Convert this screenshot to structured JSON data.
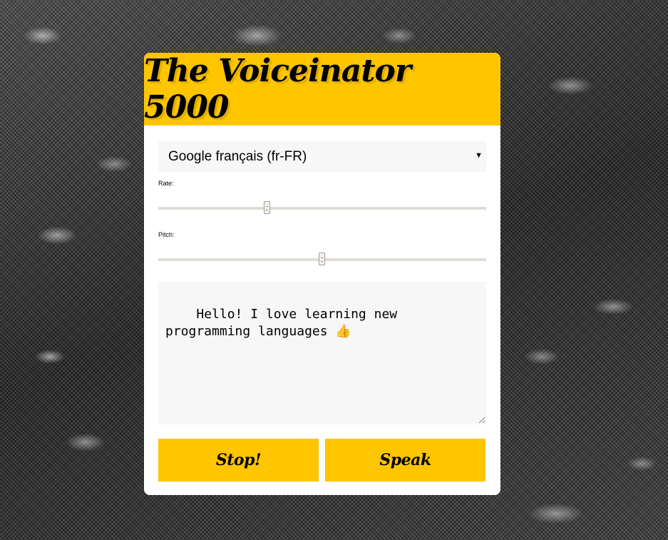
{
  "app": {
    "title": "The Voiceinator 5000"
  },
  "voice_select": {
    "selected": "Google français (fr-FR)"
  },
  "rate": {
    "label": "Rate:",
    "value": 1,
    "min": 0,
    "max": 3
  },
  "pitch": {
    "label": "Pitch:",
    "value": 1,
    "min": 0,
    "max": 2
  },
  "message": {
    "text": "Hello! I love learning new programming languages 👍"
  },
  "buttons": {
    "stop_label": "Stop!",
    "speak_label": "Speak"
  },
  "colors": {
    "accent": "#ffc600",
    "panel": "#ffffff",
    "field": "#f7f7f7"
  }
}
